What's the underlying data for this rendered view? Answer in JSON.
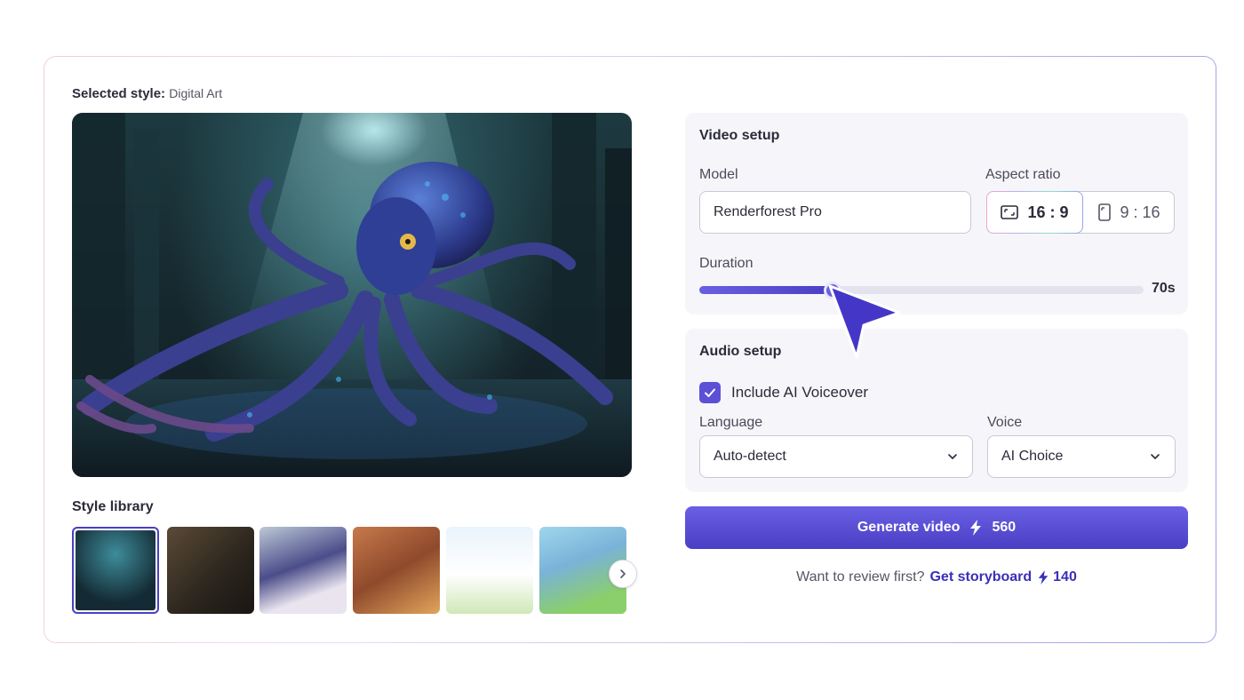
{
  "selected_style": {
    "label": "Selected style:",
    "value": "Digital Art"
  },
  "style_library": {
    "title": "Style library",
    "thumbnails": [
      "octopus-digital-art",
      "cinematic-dinner",
      "anime-girl",
      "cartoon-family",
      "doodle-dog-kite",
      "3d-robot-garden"
    ],
    "selected_index": 0
  },
  "video_setup": {
    "title": "Video setup",
    "model_label": "Model",
    "model_value": "Renderforest Pro",
    "aspect_label": "Aspect ratio",
    "aspect_options": [
      {
        "label": "16 : 9",
        "icon": "landscape-icon",
        "active": true
      },
      {
        "label": "9 : 16",
        "icon": "portrait-icon",
        "active": false
      }
    ],
    "duration_label": "Duration",
    "duration_value": "70s",
    "duration_fraction": 0.3
  },
  "audio_setup": {
    "title": "Audio setup",
    "voiceover_label": "Include AI Voiceover",
    "voiceover_checked": true,
    "language_label": "Language",
    "language_value": "Auto-detect",
    "voice_label": "Voice",
    "voice_value": "AI Choice"
  },
  "generate": {
    "label": "Generate video",
    "credits": "560"
  },
  "review": {
    "prompt": "Want to review first?",
    "link": "Get storyboard",
    "credits": "140"
  },
  "colors": {
    "accent": "#4a3fc4",
    "accent_light": "#6a60e4",
    "panel_bg": "#f6f6fa"
  }
}
